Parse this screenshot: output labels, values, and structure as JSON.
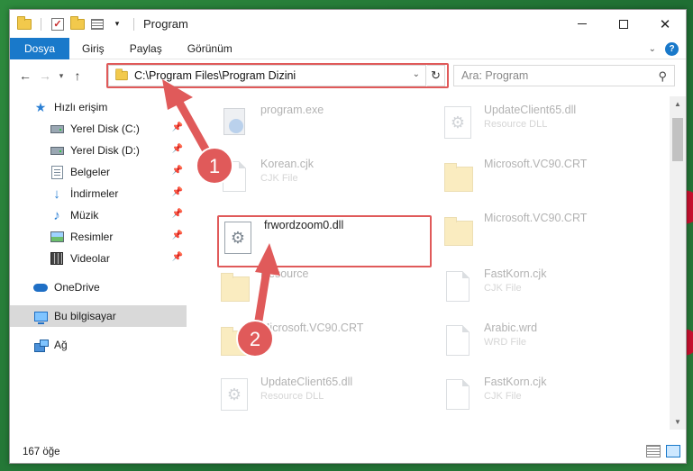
{
  "window": {
    "title": "Program"
  },
  "ribbon": {
    "tabs": [
      "Dosya",
      "Giriş",
      "Paylaş",
      "Görünüm"
    ]
  },
  "nav": {
    "address": "C:\\Program Files\\Program Dizini",
    "search_placeholder": "Ara: Program"
  },
  "sidebar": {
    "quick_access": "Hızlı erişim",
    "items": [
      {
        "label": "Yerel Disk (C:)",
        "icon": "drive-icon"
      },
      {
        "label": "Yerel Disk (D:)",
        "icon": "drive-icon"
      },
      {
        "label": "Belgeler",
        "icon": "documents-icon"
      },
      {
        "label": "İndirmeler",
        "icon": "downloads-icon"
      },
      {
        "label": "Müzik",
        "icon": "music-icon"
      },
      {
        "label": "Resimler",
        "icon": "pictures-icon"
      },
      {
        "label": "Videolar",
        "icon": "videos-icon"
      }
    ],
    "onedrive": "OneDrive",
    "this_pc": "Bu bilgisayar",
    "network": "Ağ"
  },
  "files": [
    {
      "name": "program.exe",
      "type": "",
      "icon": "exe-icon"
    },
    {
      "name": "UpdateClient65.dll",
      "type": "Resource DLL",
      "icon": "dll-icon"
    },
    {
      "name": "Korean.cjk",
      "type": "CJK File",
      "icon": "document-icon"
    },
    {
      "name": "Microsoft.VC90.CRT",
      "type": "",
      "icon": "folder-icon"
    },
    {
      "name": "frwordzoom0.dll",
      "type": "",
      "icon": "dll-icon"
    },
    {
      "name": "Microsoft.VC90.CRT",
      "type": "",
      "icon": "folder-icon"
    },
    {
      "name": "Resource",
      "type": "",
      "icon": "folder-icon"
    },
    {
      "name": "FastKorn.cjk",
      "type": "CJK File",
      "icon": "document-icon"
    },
    {
      "name": "Microsoft.VC90.CRT",
      "type": "",
      "icon": "folder-icon"
    },
    {
      "name": "Arabic.wrd",
      "type": "WRD File",
      "icon": "document-icon"
    },
    {
      "name": "UpdateClient65.dll",
      "type": "Resource DLL",
      "icon": "dll-icon"
    },
    {
      "name": "FastKorn.cjk",
      "type": "CJK File",
      "icon": "document-icon"
    }
  ],
  "status": {
    "count": "167 öğe"
  },
  "annotations": {
    "step1": "1",
    "step2": "2"
  },
  "colors": {
    "accent": "#1979ca",
    "highlight": "#e05a5a"
  }
}
